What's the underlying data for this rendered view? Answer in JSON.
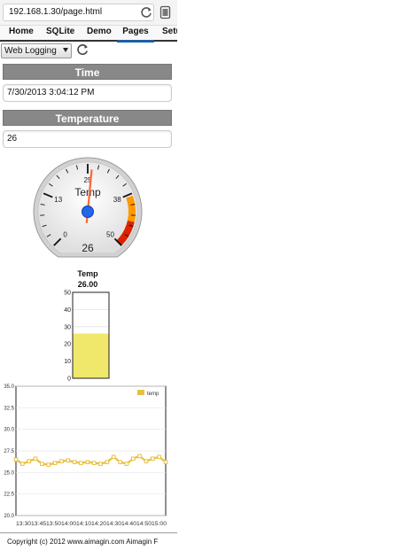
{
  "browser": {
    "url": "192.168.1.30/page.html"
  },
  "tabs": [
    {
      "label": "Home"
    },
    {
      "label": "SQLite"
    },
    {
      "label": "Demo"
    },
    {
      "label": "Pages"
    },
    {
      "label": "Setu"
    }
  ],
  "active_tab": "Pages",
  "toolbar": {
    "select_value": "Web Logging"
  },
  "time_section": {
    "header": "Time",
    "value": "7/30/2013 3:04:12 PM"
  },
  "temperature_section": {
    "header": "Temperature",
    "value": "26"
  },
  "gauge": {
    "label": "Temp",
    "value": 26,
    "value_text": "26",
    "min": 0,
    "max": 50,
    "major_ticks": [
      "0",
      "13",
      "25",
      "38",
      "50"
    ],
    "bands": [
      {
        "from": 38,
        "to": 44,
        "color": "#ff9900"
      },
      {
        "from": 44,
        "to": 50,
        "color": "#dd2200"
      }
    ],
    "needle_color": "#ff6633",
    "hub_color": "#2266ee"
  },
  "bar": {
    "label": "Temp",
    "value_text": "26.00",
    "value": 26,
    "ticks": [
      "50",
      "40",
      "30",
      "20",
      "10",
      "0"
    ],
    "fill_color": "#f0e86a"
  },
  "chart_data": {
    "type": "line",
    "y_ticks": [
      "35.0",
      "32.5",
      "30.0",
      "27.5",
      "25.0",
      "22.5",
      "20.0"
    ],
    "x_tick_labels": [
      "13:30",
      "13:45",
      "14:00",
      "14:15",
      "14:30",
      "14:45",
      "15:00"
    ],
    "x_label_strip": "13:3013:4513:5014:0014:1014:2014:3014:4014:5015:00",
    "ylim": [
      20,
      35
    ],
    "legend": "temp",
    "legend_position": "top-right",
    "series": [
      {
        "name": "temp",
        "color": "#e8c040",
        "x": [
          "13:30",
          "13:34",
          "13:38",
          "13:42",
          "13:46",
          "13:50",
          "13:54",
          "13:58",
          "14:02",
          "14:06",
          "14:10",
          "14:14",
          "14:18",
          "14:22",
          "14:26",
          "14:30",
          "14:34",
          "14:38",
          "14:42",
          "14:46",
          "14:50",
          "14:54",
          "14:58",
          "15:02"
        ],
        "values": [
          26.5,
          26.0,
          26.3,
          26.6,
          26.0,
          25.9,
          26.1,
          26.3,
          26.4,
          26.2,
          26.1,
          26.2,
          26.1,
          26.0,
          26.2,
          26.8,
          26.2,
          26.0,
          26.6,
          26.9,
          26.3,
          26.6,
          26.8,
          26.2
        ]
      }
    ]
  },
  "footer": {
    "text": "Copyright (c) 2012 www.aimagin.com Aimagin F"
  }
}
